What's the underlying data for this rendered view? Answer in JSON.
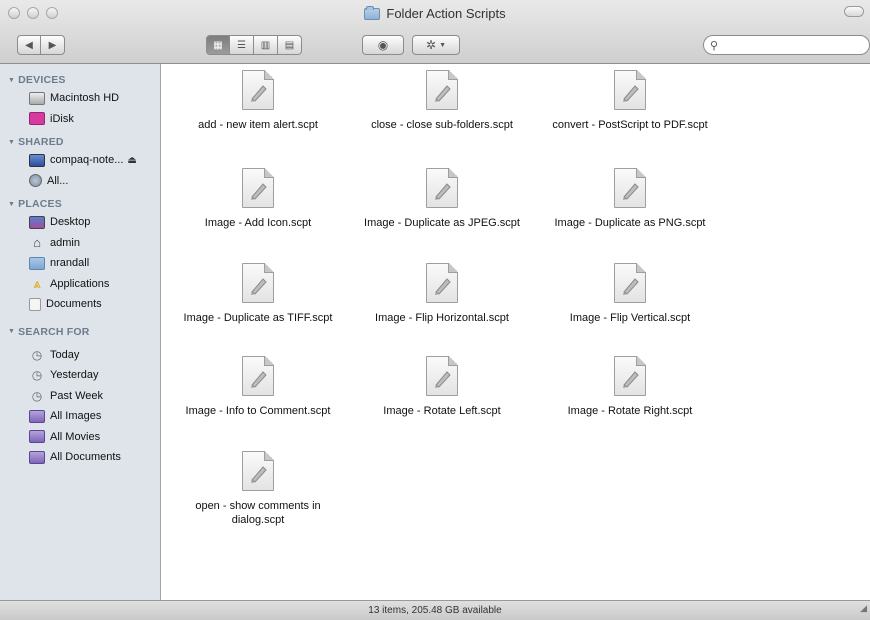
{
  "window": {
    "title": "Folder Action Scripts"
  },
  "toolbar": {
    "back_icon": "back-arrow-icon",
    "forward_icon": "forward-arrow-icon",
    "view_modes": [
      "icon-view",
      "list-view",
      "column-view",
      "cover-flow-view"
    ],
    "active_view": "icon-view",
    "action_icon": "gear-icon",
    "quicklook_icon": "eye-icon",
    "search": {
      "value": "",
      "placeholder": ""
    }
  },
  "sidebar": {
    "devices": {
      "label": "DEVICES",
      "items": [
        {
          "label": "Macintosh HD",
          "icon": "hard-drive-icon"
        },
        {
          "label": "iDisk",
          "icon": "idisk-icon"
        }
      ]
    },
    "shared": {
      "label": "SHARED",
      "items": [
        {
          "label": "compaq-note...",
          "icon": "computer-icon",
          "eject": "⏏"
        },
        {
          "label": "All...",
          "icon": "network-icon"
        }
      ]
    },
    "places": {
      "label": "PLACES",
      "items": [
        {
          "label": "Desktop",
          "icon": "desktop-icon"
        },
        {
          "label": "admin",
          "icon": "home-icon"
        },
        {
          "label": "nrandall",
          "icon": "folder-icon"
        },
        {
          "label": "Applications",
          "icon": "applications-icon"
        },
        {
          "label": "Documents",
          "icon": "documents-icon"
        }
      ]
    },
    "search_for": {
      "label": "SEARCH FOR",
      "items": [
        {
          "label": "Today",
          "icon": "clock-icon"
        },
        {
          "label": "Yesterday",
          "icon": "clock-icon"
        },
        {
          "label": "Past Week",
          "icon": "clock-icon"
        },
        {
          "label": "All Images",
          "icon": "smart-folder-icon"
        },
        {
          "label": "All Movies",
          "icon": "smart-folder-icon"
        },
        {
          "label": "All Documents",
          "icon": "smart-folder-icon"
        }
      ]
    }
  },
  "files": [
    {
      "name": "add - new item alert.scpt"
    },
    {
      "name": "close - close sub-folders.scpt"
    },
    {
      "name": "convert - PostScript to PDF.scpt"
    },
    {
      "name": "Image - Add Icon.scpt"
    },
    {
      "name": "Image - Duplicate as JPEG.scpt"
    },
    {
      "name": "Image - Duplicate as PNG.scpt"
    },
    {
      "name": "Image - Duplicate as TIFF.scpt"
    },
    {
      "name": "Image - Flip Horizontal.scpt"
    },
    {
      "name": "Image - Flip Vertical.scpt"
    },
    {
      "name": "Image - Info to Comment.scpt"
    },
    {
      "name": "Image - Rotate Left.scpt"
    },
    {
      "name": "Image - Rotate Right.scpt"
    },
    {
      "name": "open - show comments in dialog.scpt"
    }
  ],
  "status": {
    "text": "13 items, 205.48 GB available"
  }
}
